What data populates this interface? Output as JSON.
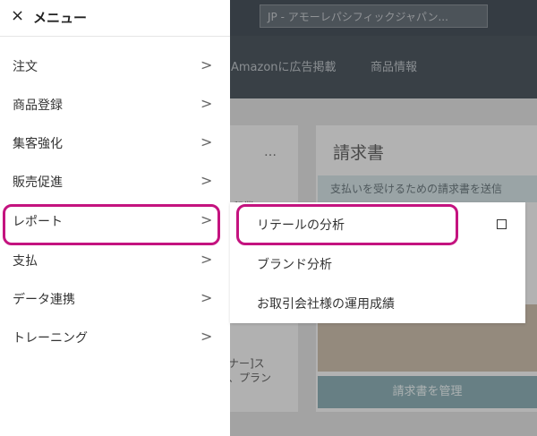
{
  "header": {
    "close_icon": "×",
    "title": "メニュー"
  },
  "marketplace": {
    "label": "JP - アモーレパシフィックジャパン..."
  },
  "nav": [
    "Amazonに広告掲載",
    "商品情報"
  ],
  "menu": {
    "items": [
      {
        "label": "注文",
        "chevron": ">"
      },
      {
        "label": "商品登録",
        "chevron": ">"
      },
      {
        "label": "集客強化",
        "chevron": ">"
      },
      {
        "label": "販売促進",
        "chevron": ">"
      },
      {
        "label": "レポート",
        "chevron": ">"
      },
      {
        "label": "支払",
        "chevron": ">"
      },
      {
        "label": "データ連携",
        "chevron": ">"
      },
      {
        "label": "トレーニング",
        "chevron": ">"
      }
    ]
  },
  "submenu": {
    "items": [
      {
        "label": "リテールの分析"
      },
      {
        "label": "ブランド分析"
      },
      {
        "label": "お取引会社様の運用成績"
      }
    ]
  },
  "cards": {
    "dots": "…",
    "fragment_top": "印業",
    "fragment_bottom_1": "ナー]ス",
    "fragment_bottom_2": "、プラン",
    "invoice_title": "請求書",
    "invoice_sub": "支払いを受けるための請求書を送信",
    "invoice_button": "請求書を管理"
  },
  "colors": {
    "highlight": "#c4137f",
    "topbar": "#4a545e"
  }
}
